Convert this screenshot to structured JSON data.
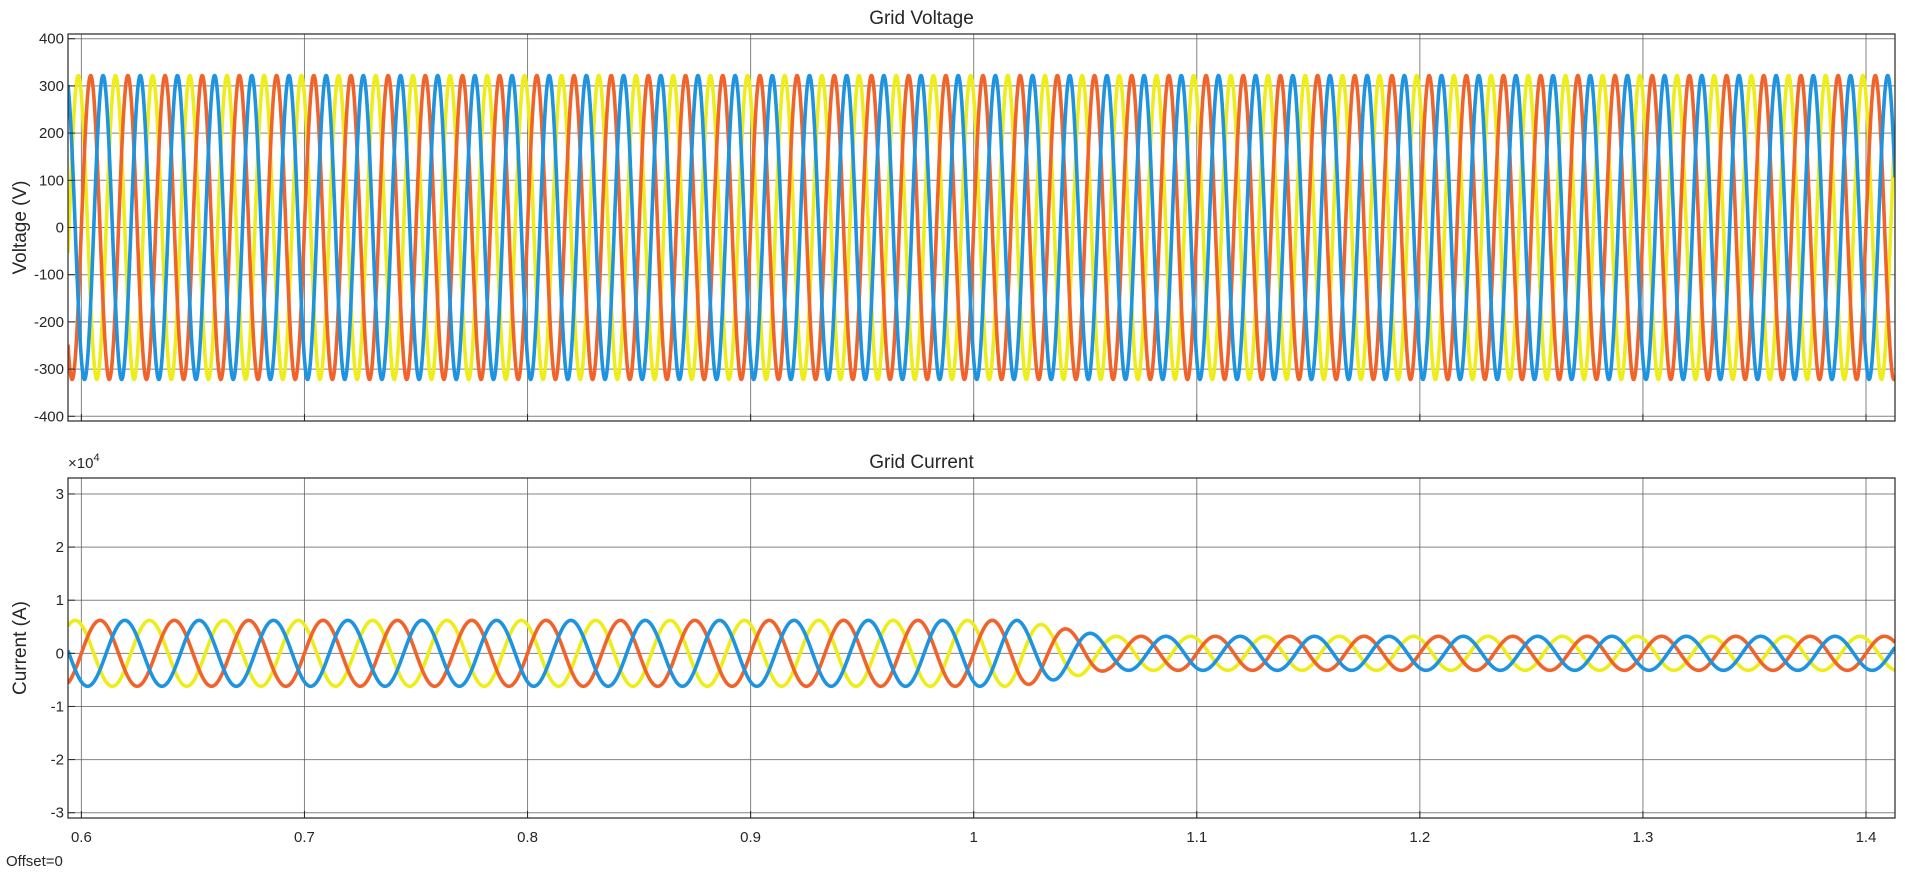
{
  "footer_text": "Offset=0",
  "colors": {
    "phase_a": "#EDED1C",
    "phase_b": "#F0642C",
    "phase_c": "#1E93DF",
    "grid": "#5a5a5a",
    "axes": "#262626"
  },
  "chart_data": [
    {
      "type": "line",
      "title": "Grid Voltage",
      "xlabel": "",
      "ylabel": "Voltage (V)",
      "xlim": [
        0.594,
        1.413
      ],
      "ylim": [
        -410,
        410
      ],
      "xticks": [
        0.6,
        0.7,
        0.8,
        0.9,
        1.0,
        1.1,
        1.2,
        1.3,
        1.4
      ],
      "xtick_labels": [],
      "yticks": [
        -400,
        -300,
        -200,
        -100,
        0,
        100,
        200,
        300,
        400
      ],
      "ytick_labels": [
        "-400",
        "-300",
        "-200",
        "-100",
        "0",
        "100",
        "200",
        "300",
        "400"
      ],
      "grid": true,
      "legend": false,
      "frequency_hz": 60,
      "series": [
        {
          "color": "#EDED1C",
          "segments": [
            {
              "from": 0.594,
              "to": 1.413,
              "amplitude": 322
            }
          ],
          "phase_deg": 120
        },
        {
          "color": "#F0642C",
          "segments": [
            {
              "from": 0.594,
              "to": 1.413,
              "amplitude": 322
            }
          ],
          "phase_deg": 0
        },
        {
          "color": "#1E93DF",
          "segments": [
            {
              "from": 0.594,
              "to": 1.413,
              "amplitude": 322
            }
          ],
          "phase_deg": -120
        }
      ]
    },
    {
      "type": "line",
      "title": "Grid Current",
      "xlabel": "",
      "ylabel": "Current (A)",
      "y_multiplier": "×10",
      "y_multiplier_exponent": "4",
      "xlim": [
        0.594,
        1.413
      ],
      "ylim": [
        -3.1,
        3.3
      ],
      "xticks": [
        0.6,
        0.7,
        0.8,
        0.9,
        1.0,
        1.1,
        1.2,
        1.3,
        1.4
      ],
      "xtick_labels": [
        "0.6",
        "0.7",
        "0.8",
        "0.9",
        "1",
        "1.1",
        "1.2",
        "1.3",
        "1.4"
      ],
      "yticks": [
        -3,
        -2,
        -1,
        0,
        1,
        2,
        3
      ],
      "ytick_labels": [
        "-3",
        "-2",
        "-1",
        "0",
        "1",
        "2",
        "3"
      ],
      "grid": true,
      "legend": false,
      "frequency_hz": 30,
      "series": [
        {
          "color": "#EDED1C",
          "segments": [
            {
              "from": 0.594,
              "to": 1.02,
              "amplitude": 0.62
            },
            {
              "from": 1.06,
              "to": 1.413,
              "amplitude": 0.32
            }
          ],
          "phase_deg": 120
        },
        {
          "color": "#F0642C",
          "segments": [
            {
              "from": 0.594,
              "to": 1.02,
              "amplitude": 0.62
            },
            {
              "from": 1.06,
              "to": 1.413,
              "amplitude": 0.32
            }
          ],
          "phase_deg": 0
        },
        {
          "color": "#1E93DF",
          "segments": [
            {
              "from": 0.594,
              "to": 1.02,
              "amplitude": 0.62
            },
            {
              "from": 1.06,
              "to": 1.413,
              "amplitude": 0.32
            }
          ],
          "phase_deg": -120
        }
      ]
    }
  ]
}
